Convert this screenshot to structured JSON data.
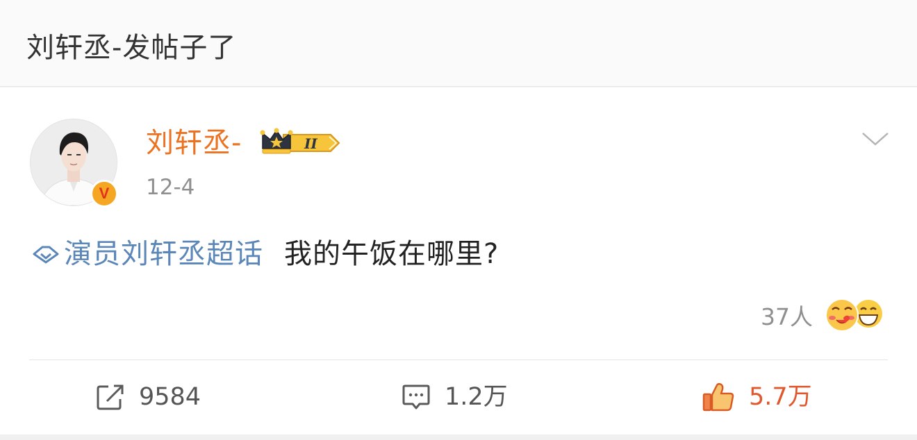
{
  "page_title": "刘轩丞-发帖子了",
  "post": {
    "author": "刘轩丞-",
    "verified_badge": "V",
    "membership_badge": "II",
    "time": "12-4",
    "topic": "演员刘轩丞超话",
    "text": "我的午饭在哪里?",
    "reactors": {
      "count_label": "37人"
    }
  },
  "actions": {
    "repost": "9584",
    "comment": "1.2万",
    "like": "5.7万"
  },
  "colors": {
    "author_name": "#eb7221",
    "topic_link": "#5b86b8",
    "liked": "#e0582e",
    "verify_badge": "#f5a623"
  }
}
